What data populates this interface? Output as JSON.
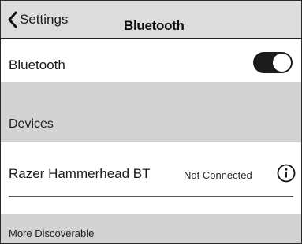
{
  "nav": {
    "back_label": "Settings",
    "back_icon": "chevron-left-icon",
    "title": "Bluetooth"
  },
  "bluetooth": {
    "label": "Bluetooth",
    "enabled": true
  },
  "devices": {
    "header": "Devices",
    "items": [
      {
        "name": "Razer Hammerhead BT",
        "status": "Not Connected",
        "info_icon": "info-icon"
      }
    ]
  },
  "footer": {
    "label": "More Discoverable"
  }
}
